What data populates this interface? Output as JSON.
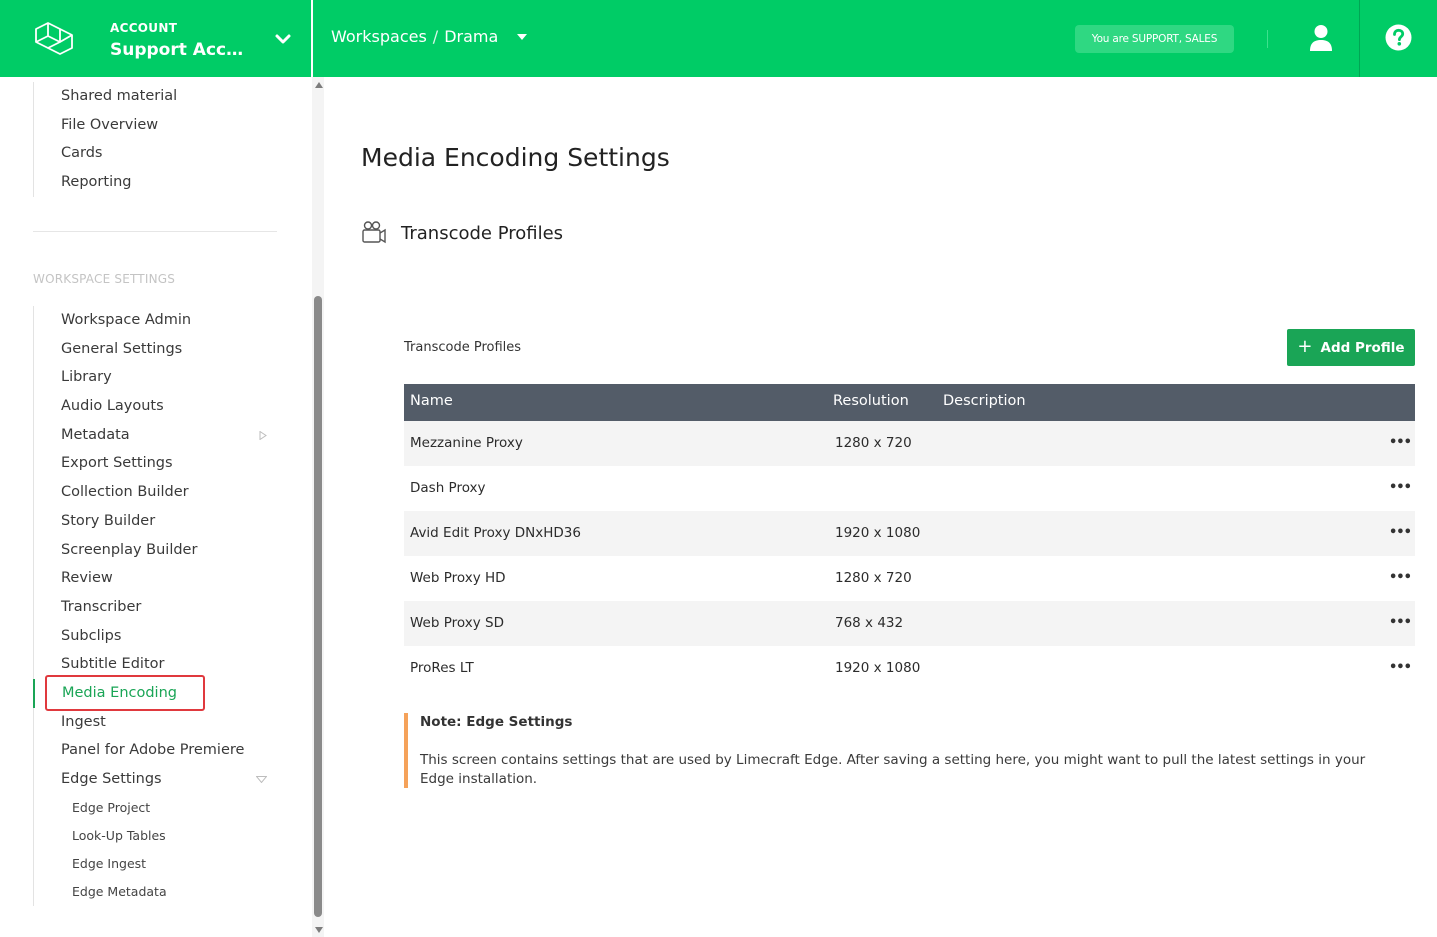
{
  "topbar": {
    "account_label": "ACCOUNT",
    "account_name": "Support Acco...",
    "breadcrumb": [
      "Workspaces",
      "Drama"
    ],
    "breadcrumb_separator": "/",
    "role_badge": "You are SUPPORT, SALES",
    "accent_color": "#00cc66",
    "icons": [
      "logo-icon",
      "chevron-down-icon",
      "caret-down-icon",
      "user-icon",
      "help-icon"
    ]
  },
  "sidebar": {
    "top_items": [
      {
        "label": "Shared material"
      },
      {
        "label": "File Overview"
      },
      {
        "label": "Cards"
      },
      {
        "label": "Reporting"
      }
    ],
    "workspace_heading": "WORKSPACE SETTINGS",
    "items": [
      {
        "label": "Workspace Admin"
      },
      {
        "label": "General Settings"
      },
      {
        "label": "Library"
      },
      {
        "label": "Audio Layouts"
      },
      {
        "label": "Metadata"
      },
      {
        "label": "Export Settings"
      },
      {
        "label": "Collection Builder"
      },
      {
        "label": "Story Builder"
      },
      {
        "label": "Screenplay Builder"
      },
      {
        "label": "Review"
      },
      {
        "label": "Transcriber"
      },
      {
        "label": "Subclips"
      },
      {
        "label": "Subtitle Editor"
      },
      {
        "label": "Media Encoding"
      },
      {
        "label": "Ingest"
      },
      {
        "label": "Panel for Adobe Premiere"
      },
      {
        "label": "Edge Settings"
      }
    ],
    "sub_items": [
      {
        "label": "Edge Project"
      },
      {
        "label": "Look-Up Tables"
      },
      {
        "label": "Edge Ingest"
      },
      {
        "label": "Edge Metadata"
      }
    ],
    "active_item": "Media Encoding",
    "active_color": "#1aa556"
  },
  "main": {
    "page_title": "Media Encoding Settings",
    "section_title": "Transcode Profiles",
    "table_label": "Transcode Profiles",
    "add_button": "Add Profile",
    "add_button_icon": "plus-icon",
    "columns": [
      "Name",
      "Resolution",
      "Description"
    ],
    "rows": [
      {
        "name": "Mezzanine Proxy",
        "resolution": "1280 x 720",
        "description": ""
      },
      {
        "name": "Dash Proxy",
        "resolution": "",
        "description": ""
      },
      {
        "name": "Avid Edit Proxy DNxHD36",
        "resolution": "1920 x 1080",
        "description": ""
      },
      {
        "name": "Web Proxy HD",
        "resolution": "1280 x 720",
        "description": ""
      },
      {
        "name": "Web Proxy SD",
        "resolution": "768 x 432",
        "description": ""
      },
      {
        "name": "ProRes LT",
        "resolution": "1920 x 1080",
        "description": ""
      }
    ],
    "row_menu_glyph": "•••",
    "note": {
      "title": "Note: Edge Settings",
      "body": "This screen contains settings that are used by Limecraft Edge. After saving a setting here, you might want to pull the latest settings in your Edge installation.",
      "accent_color": "#f5a25a"
    }
  }
}
